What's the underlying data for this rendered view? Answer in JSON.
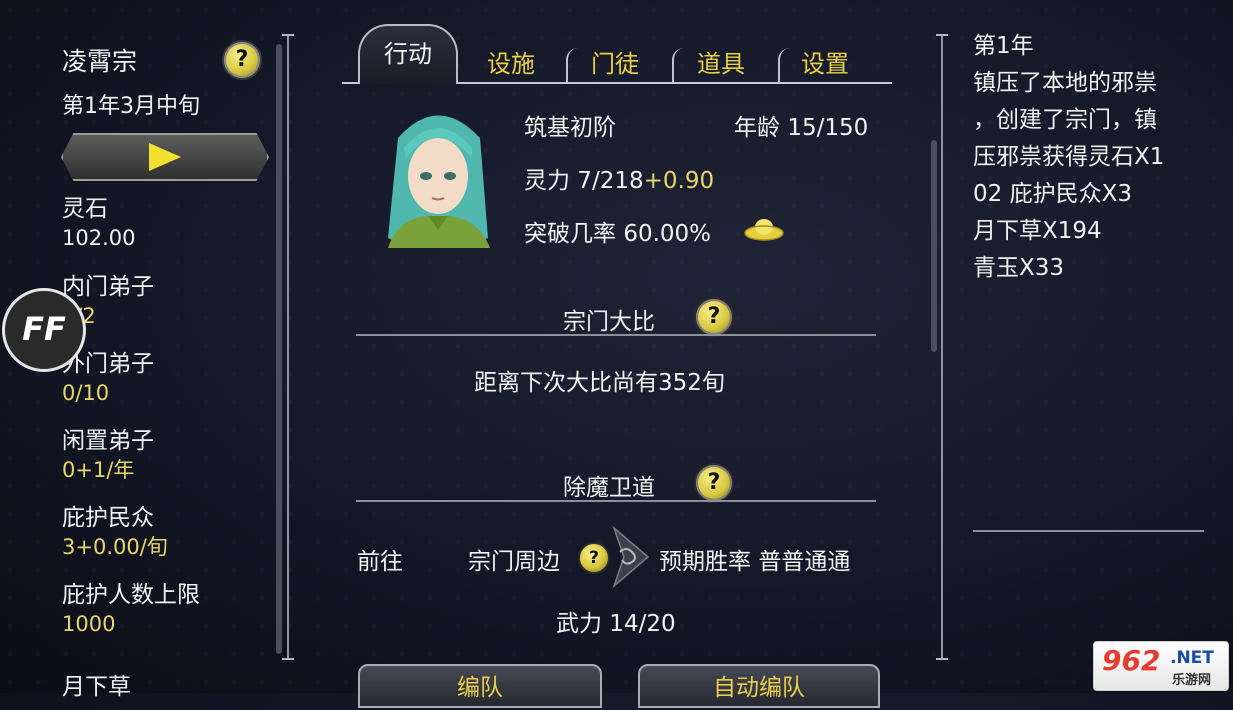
{
  "sidebar": {
    "sect_name": "凌霄宗",
    "date": "第1年3月中旬",
    "stats": [
      {
        "label": "灵石",
        "value": "102.00"
      },
      {
        "label": "内门弟子",
        "value": "0/2"
      },
      {
        "label": "外门弟子",
        "value": "0/10"
      },
      {
        "label": "闲置弟子",
        "value": "0+1/年"
      },
      {
        "label": "庇护民众",
        "value": "3+0.00/旬"
      },
      {
        "label": "庇护人数上限",
        "value": "1000"
      },
      {
        "label": "月下草",
        "value": ""
      }
    ]
  },
  "tabs": [
    "行动",
    "设施",
    "门徒",
    "道具",
    "设置"
  ],
  "character": {
    "realm": "筑基初阶",
    "age_label": "年龄",
    "age_value": "15/150",
    "spirit_label": "灵力",
    "spirit_value": "7/218",
    "spirit_rate": "+0.90",
    "break_label": "突破几率",
    "break_value": "60.00%"
  },
  "tournament": {
    "title": "宗门大比",
    "help": "?",
    "countdown": "距离下次大比尚有352旬"
  },
  "demon": {
    "title": "除魔卫道",
    "help": "?",
    "go_label": "前往",
    "location": "宗门周边",
    "win_label": "预期胜率",
    "win_value": "普普通通",
    "power": "武力 14/20"
  },
  "buttons": {
    "team": "编队",
    "auto_team": "自动编队",
    "help": "?"
  },
  "log": {
    "lines": [
      {
        "text": "第1年",
        "color": "#f2f2f2"
      },
      {
        "text": "镇压了本地的邪祟",
        "color": "#f2f2f2"
      },
      {
        "text": "，创建了宗门，镇",
        "color": "#f2f2f2"
      },
      {
        "text": "压邪祟获得灵石X1",
        "color": "#f2f2f2"
      },
      {
        "text": "02 庇护民众X3",
        "color": "#f2f2f2"
      },
      {
        "text": "月下草X194",
        "color": "#f2f2f2"
      },
      {
        "text": "青玉X33",
        "color": "#f2f2f2"
      }
    ]
  },
  "overlay": {
    "ff_logo": "FF",
    "watermark_big": "962",
    "watermark_net": ".NET",
    "watermark_small": "乐游网"
  },
  "colors": {
    "accent_yellow": "#e9d66b",
    "background": "#131726"
  }
}
